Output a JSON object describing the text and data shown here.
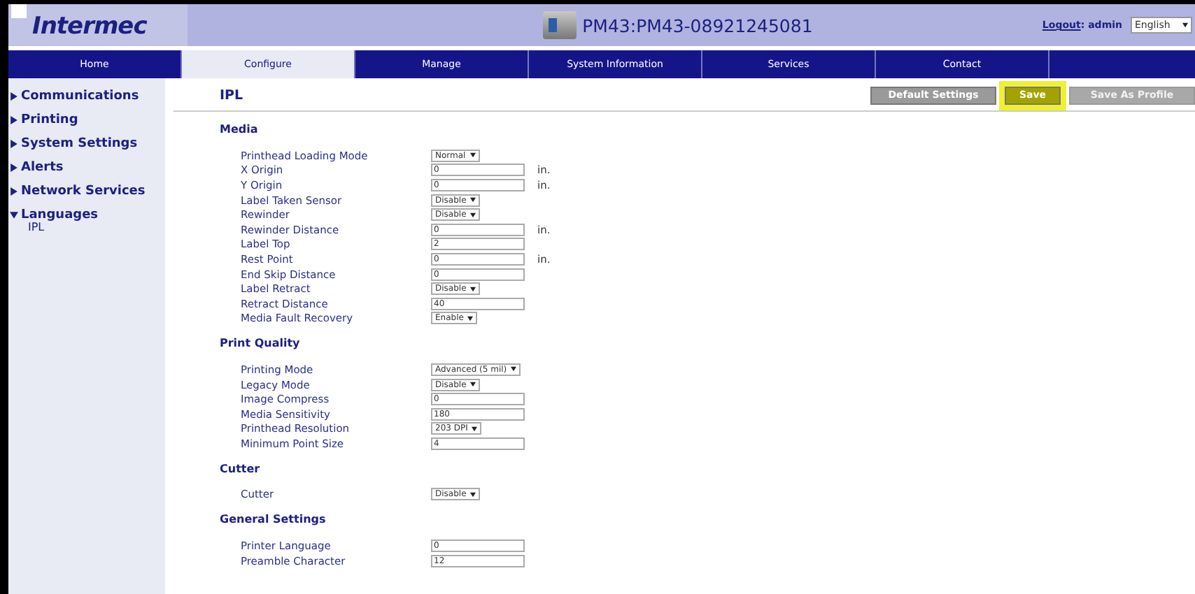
{
  "header": {
    "logo": "Intermec",
    "device": "PM43:PM43-08921245081",
    "logout": "Logout",
    "user": ": admin",
    "language": "English"
  },
  "nav": [
    {
      "label": "Home",
      "selected": false
    },
    {
      "label": "Configure",
      "selected": true
    },
    {
      "label": "Manage",
      "selected": false
    },
    {
      "label": "System Information",
      "selected": false
    },
    {
      "label": "Services",
      "selected": false
    },
    {
      "label": "Contact",
      "selected": false
    }
  ],
  "sidebar": [
    {
      "label": "Communications",
      "expanded": false
    },
    {
      "label": "Printing",
      "expanded": false
    },
    {
      "label": "System Settings",
      "expanded": false
    },
    {
      "label": "Alerts",
      "expanded": false
    },
    {
      "label": "Network Services",
      "expanded": false
    },
    {
      "label": "Languages",
      "expanded": true,
      "children": [
        {
          "label": "IPL"
        }
      ]
    }
  ],
  "page_title": "IPL",
  "buttons": [
    {
      "label": "Default Settings",
      "disabled": false,
      "highlighted": false
    },
    {
      "label": "Save",
      "disabled": false,
      "highlighted": true
    },
    {
      "label": "Save As Profile",
      "disabled": true,
      "highlighted": false
    }
  ],
  "sections": [
    {
      "title": "Media",
      "fields": [
        {
          "label": "Printhead Loading Mode",
          "kind": "select",
          "value": "Normal"
        },
        {
          "label": "X Origin",
          "kind": "text",
          "value": "0",
          "unit": "in."
        },
        {
          "label": "Y Origin",
          "kind": "text",
          "value": "0",
          "unit": "in."
        },
        {
          "label": "Label Taken Sensor",
          "kind": "select",
          "value": "Disable"
        },
        {
          "label": "Rewinder",
          "kind": "select",
          "value": "Disable"
        },
        {
          "label": "Rewinder Distance",
          "kind": "text",
          "value": "0",
          "unit": "in."
        },
        {
          "label": "Label Top",
          "kind": "text",
          "value": "2"
        },
        {
          "label": "Rest Point",
          "kind": "text",
          "value": "0",
          "unit": "in."
        },
        {
          "label": "End Skip Distance",
          "kind": "text",
          "value": "0"
        },
        {
          "label": "Label Retract",
          "kind": "select",
          "value": "Disable"
        },
        {
          "label": "Retract Distance",
          "kind": "text",
          "value": "40"
        },
        {
          "label": "Media Fault Recovery",
          "kind": "select",
          "value": "Enable"
        }
      ]
    },
    {
      "title": "Print Quality",
      "fields": [
        {
          "label": "Printing Mode",
          "kind": "select",
          "value": "Advanced (5 mil)"
        },
        {
          "label": "Legacy Mode",
          "kind": "select",
          "value": "Disable"
        },
        {
          "label": "Image Compress",
          "kind": "text",
          "value": "0"
        },
        {
          "label": "Media Sensitivity",
          "kind": "text",
          "value": "180"
        },
        {
          "label": "Printhead Resolution",
          "kind": "select",
          "value": "203 DPI"
        },
        {
          "label": "Minimum Point Size",
          "kind": "text",
          "value": "4"
        }
      ]
    },
    {
      "title": "Cutter",
      "fields": [
        {
          "label": "Cutter",
          "kind": "select",
          "value": "Disable"
        }
      ]
    },
    {
      "title": "General Settings",
      "fields": [
        {
          "label": "Printer Language",
          "kind": "text",
          "value": "0"
        },
        {
          "label": "Preamble Character",
          "kind": "text",
          "value": "12"
        }
      ]
    }
  ]
}
